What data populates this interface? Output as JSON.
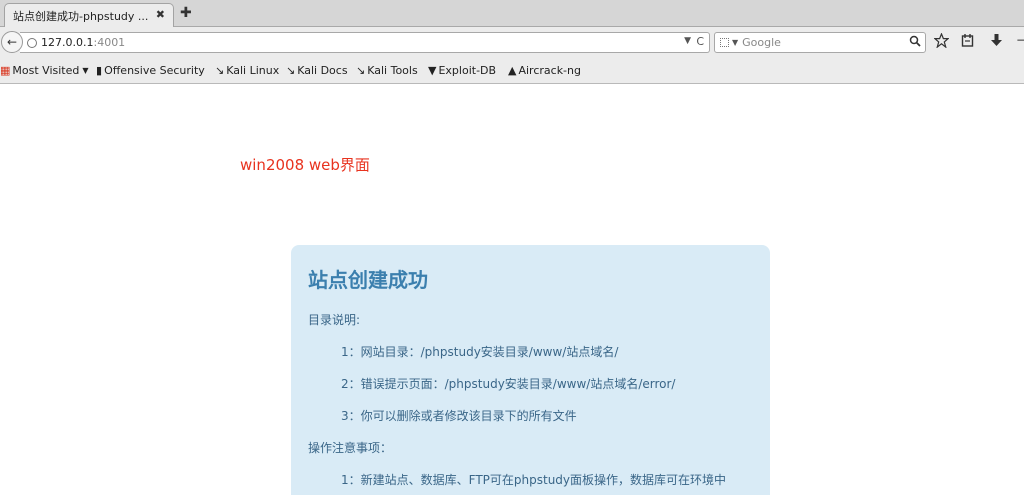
{
  "tab": {
    "title": "站点创建成功-phpstudy ...",
    "close": "✖",
    "new": "✚"
  },
  "nav": {
    "back": "←",
    "url_host": "127.0.0.1",
    "url_port": ":4001",
    "url_dropdown": "▼",
    "reload": "C",
    "search_placeholder": "Google",
    "search_dropdown": "▼",
    "icons": [
      "search-icon",
      "bookmark-star-icon",
      "reading-list-icon",
      "downloads-icon",
      "overflow-icon"
    ]
  },
  "bookmarks": [
    {
      "label": "Most Visited",
      "icon": "▦",
      "icon_color": "#d9331c",
      "dropdown": "▼"
    },
    {
      "label": "Offensive Security",
      "icon": "▮",
      "icon_color": "#222222"
    },
    {
      "label": "Kali Linux",
      "icon": "↘",
      "icon_color": "#222222"
    },
    {
      "label": "Kali Docs",
      "icon": "↘",
      "icon_color": "#222222"
    },
    {
      "label": "Kali Tools",
      "icon": "↘",
      "icon_color": "#222222"
    },
    {
      "label": "Exploit-DB",
      "icon": "▼",
      "icon_color": "#222222"
    },
    {
      "label": "Aircrack-ng",
      "icon": "▲",
      "icon_color": "#222222"
    }
  ],
  "page": {
    "heading": "win2008 web界面",
    "panel_title": "站点创建成功",
    "lines": [
      "目录说明:",
      "1：网站目录：/phpstudy安装目录/www/站点域名/",
      "2：错误提示页面：/phpstudy安装目录/www/站点域名/error/",
      "3：你可以删除或者修改该目录下的所有文件",
      "操作注意事项：",
      "1：新建站点、数据库、FTP可在phpstudy面板操作，数据库可在环境中"
    ]
  },
  "colors": {
    "heading": "#e8331f",
    "panel_bg": "#d9ebf6",
    "panel_title": "#3b7fae",
    "panel_text": "#3a6688"
  }
}
